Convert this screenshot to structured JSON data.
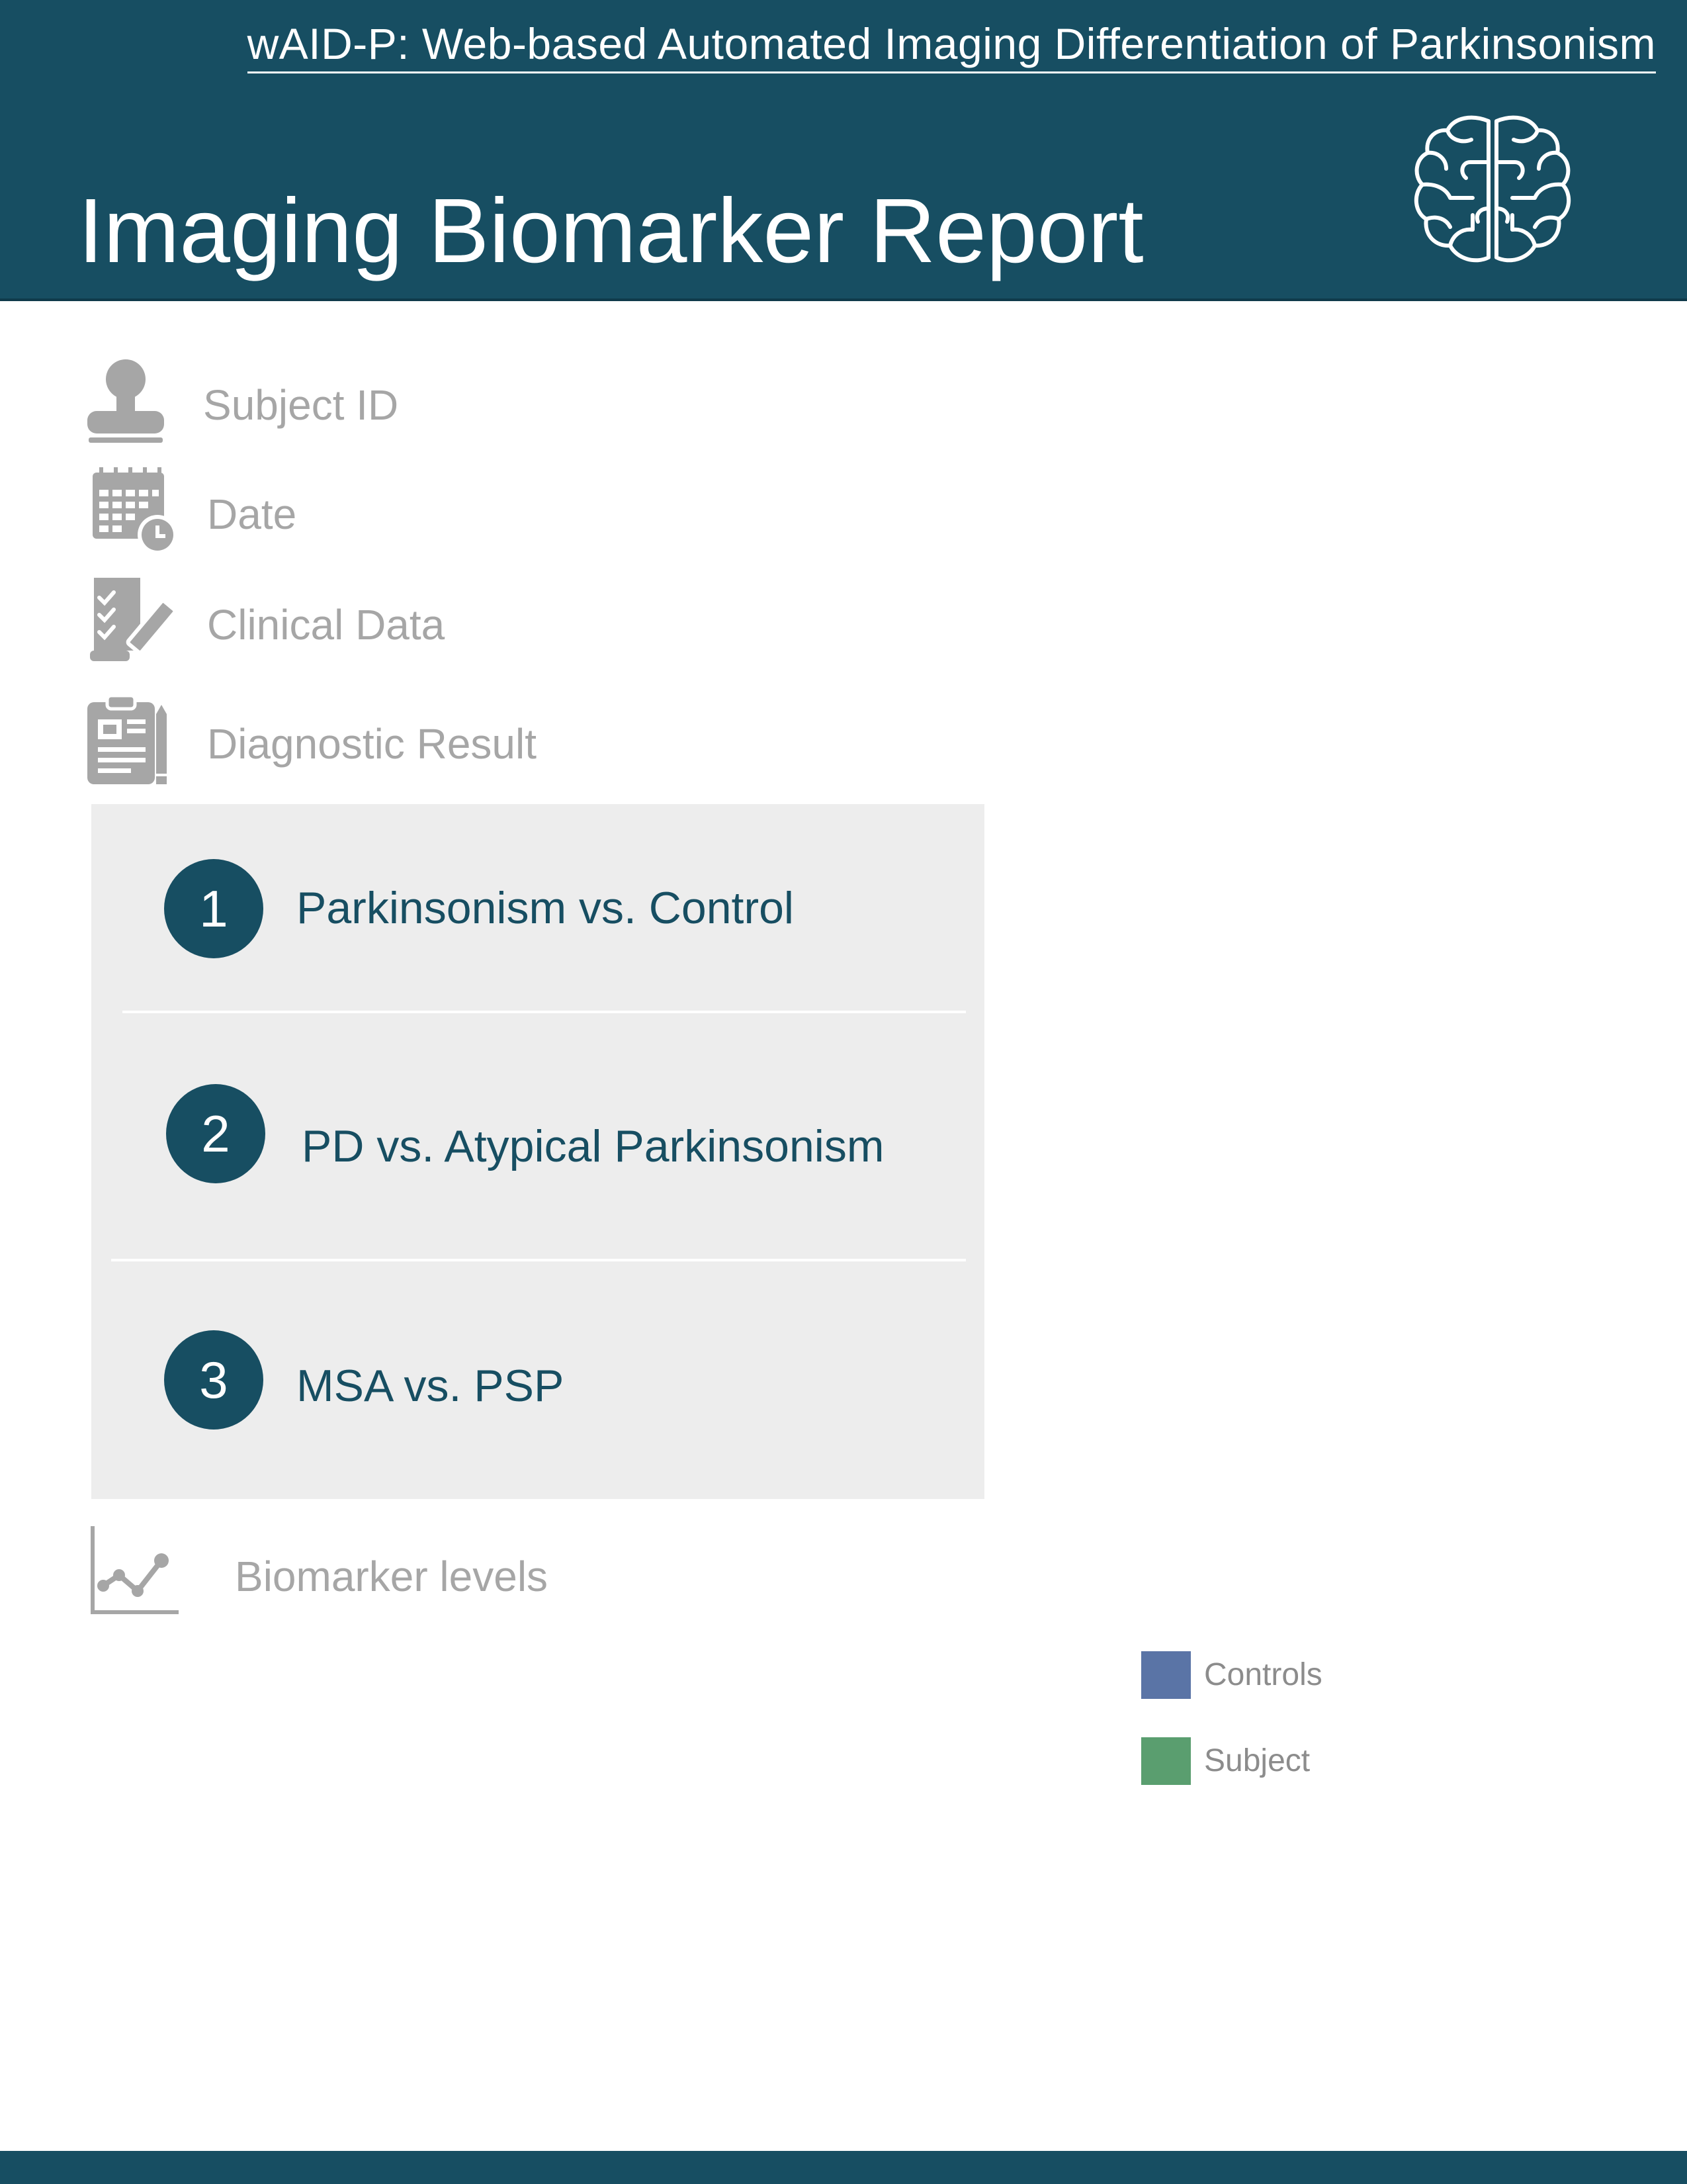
{
  "header": {
    "app_name": "wAID-P: Web-based Automated Imaging Differentiation of Parkinsonism",
    "title": "Imaging Biomarker Report",
    "brand_color": "#174e62",
    "logo_icon": "brain-icon"
  },
  "info": {
    "subject_id": {
      "label": "Subject ID",
      "icon": "person-icon"
    },
    "date": {
      "label": "Date",
      "icon": "calendar-clock-icon"
    },
    "clinical_data": {
      "label": "Clinical Data",
      "icon": "checklist-pencil-icon"
    },
    "diagnostic_result": {
      "label": "Diagnostic Result",
      "icon": "clipboard-icon"
    }
  },
  "diagnostics": [
    {
      "number": "1",
      "label": "Parkinsonism vs. Control"
    },
    {
      "number": "2",
      "label": "PD vs. Atypical Parkinsonism"
    },
    {
      "number": "3",
      "label": "MSA vs. PSP"
    }
  ],
  "biomarker": {
    "label": "Biomarker levels",
    "icon": "line-chart-icon"
  },
  "legend": [
    {
      "label": "Controls",
      "color": "#5a74a6"
    },
    {
      "label": "Subject",
      "color": "#5a9e6f"
    }
  ]
}
